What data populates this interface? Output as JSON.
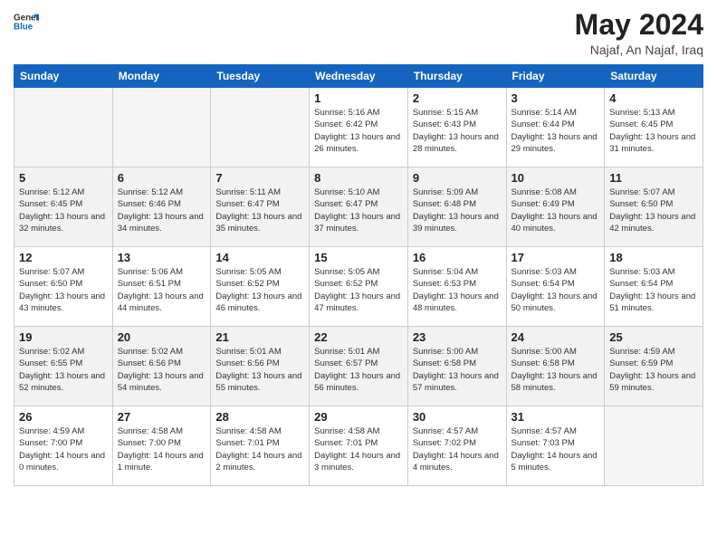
{
  "header": {
    "logo_general": "General",
    "logo_blue": "Blue",
    "title": "May 2024",
    "subtitle": "Najaf, An Najaf, Iraq"
  },
  "weekdays": [
    "Sunday",
    "Monday",
    "Tuesday",
    "Wednesday",
    "Thursday",
    "Friday",
    "Saturday"
  ],
  "weeks": [
    [
      {
        "day": "",
        "sunrise": "",
        "sunset": "",
        "daylight": ""
      },
      {
        "day": "",
        "sunrise": "",
        "sunset": "",
        "daylight": ""
      },
      {
        "day": "",
        "sunrise": "",
        "sunset": "",
        "daylight": ""
      },
      {
        "day": "1",
        "sunrise": "Sunrise: 5:16 AM",
        "sunset": "Sunset: 6:42 PM",
        "daylight": "Daylight: 13 hours and 26 minutes."
      },
      {
        "day": "2",
        "sunrise": "Sunrise: 5:15 AM",
        "sunset": "Sunset: 6:43 PM",
        "daylight": "Daylight: 13 hours and 28 minutes."
      },
      {
        "day": "3",
        "sunrise": "Sunrise: 5:14 AM",
        "sunset": "Sunset: 6:44 PM",
        "daylight": "Daylight: 13 hours and 29 minutes."
      },
      {
        "day": "4",
        "sunrise": "Sunrise: 5:13 AM",
        "sunset": "Sunset: 6:45 PM",
        "daylight": "Daylight: 13 hours and 31 minutes."
      }
    ],
    [
      {
        "day": "5",
        "sunrise": "Sunrise: 5:12 AM",
        "sunset": "Sunset: 6:45 PM",
        "daylight": "Daylight: 13 hours and 32 minutes."
      },
      {
        "day": "6",
        "sunrise": "Sunrise: 5:12 AM",
        "sunset": "Sunset: 6:46 PM",
        "daylight": "Daylight: 13 hours and 34 minutes."
      },
      {
        "day": "7",
        "sunrise": "Sunrise: 5:11 AM",
        "sunset": "Sunset: 6:47 PM",
        "daylight": "Daylight: 13 hours and 35 minutes."
      },
      {
        "day": "8",
        "sunrise": "Sunrise: 5:10 AM",
        "sunset": "Sunset: 6:47 PM",
        "daylight": "Daylight: 13 hours and 37 minutes."
      },
      {
        "day": "9",
        "sunrise": "Sunrise: 5:09 AM",
        "sunset": "Sunset: 6:48 PM",
        "daylight": "Daylight: 13 hours and 39 minutes."
      },
      {
        "day": "10",
        "sunrise": "Sunrise: 5:08 AM",
        "sunset": "Sunset: 6:49 PM",
        "daylight": "Daylight: 13 hours and 40 minutes."
      },
      {
        "day": "11",
        "sunrise": "Sunrise: 5:07 AM",
        "sunset": "Sunset: 6:50 PM",
        "daylight": "Daylight: 13 hours and 42 minutes."
      }
    ],
    [
      {
        "day": "12",
        "sunrise": "Sunrise: 5:07 AM",
        "sunset": "Sunset: 6:50 PM",
        "daylight": "Daylight: 13 hours and 43 minutes."
      },
      {
        "day": "13",
        "sunrise": "Sunrise: 5:06 AM",
        "sunset": "Sunset: 6:51 PM",
        "daylight": "Daylight: 13 hours and 44 minutes."
      },
      {
        "day": "14",
        "sunrise": "Sunrise: 5:05 AM",
        "sunset": "Sunset: 6:52 PM",
        "daylight": "Daylight: 13 hours and 46 minutes."
      },
      {
        "day": "15",
        "sunrise": "Sunrise: 5:05 AM",
        "sunset": "Sunset: 6:52 PM",
        "daylight": "Daylight: 13 hours and 47 minutes."
      },
      {
        "day": "16",
        "sunrise": "Sunrise: 5:04 AM",
        "sunset": "Sunset: 6:53 PM",
        "daylight": "Daylight: 13 hours and 48 minutes."
      },
      {
        "day": "17",
        "sunrise": "Sunrise: 5:03 AM",
        "sunset": "Sunset: 6:54 PM",
        "daylight": "Daylight: 13 hours and 50 minutes."
      },
      {
        "day": "18",
        "sunrise": "Sunrise: 5:03 AM",
        "sunset": "Sunset: 6:54 PM",
        "daylight": "Daylight: 13 hours and 51 minutes."
      }
    ],
    [
      {
        "day": "19",
        "sunrise": "Sunrise: 5:02 AM",
        "sunset": "Sunset: 6:55 PM",
        "daylight": "Daylight: 13 hours and 52 minutes."
      },
      {
        "day": "20",
        "sunrise": "Sunrise: 5:02 AM",
        "sunset": "Sunset: 6:56 PM",
        "daylight": "Daylight: 13 hours and 54 minutes."
      },
      {
        "day": "21",
        "sunrise": "Sunrise: 5:01 AM",
        "sunset": "Sunset: 6:56 PM",
        "daylight": "Daylight: 13 hours and 55 minutes."
      },
      {
        "day": "22",
        "sunrise": "Sunrise: 5:01 AM",
        "sunset": "Sunset: 6:57 PM",
        "daylight": "Daylight: 13 hours and 56 minutes."
      },
      {
        "day": "23",
        "sunrise": "Sunrise: 5:00 AM",
        "sunset": "Sunset: 6:58 PM",
        "daylight": "Daylight: 13 hours and 57 minutes."
      },
      {
        "day": "24",
        "sunrise": "Sunrise: 5:00 AM",
        "sunset": "Sunset: 6:58 PM",
        "daylight": "Daylight: 13 hours and 58 minutes."
      },
      {
        "day": "25",
        "sunrise": "Sunrise: 4:59 AM",
        "sunset": "Sunset: 6:59 PM",
        "daylight": "Daylight: 13 hours and 59 minutes."
      }
    ],
    [
      {
        "day": "26",
        "sunrise": "Sunrise: 4:59 AM",
        "sunset": "Sunset: 7:00 PM",
        "daylight": "Daylight: 14 hours and 0 minutes."
      },
      {
        "day": "27",
        "sunrise": "Sunrise: 4:58 AM",
        "sunset": "Sunset: 7:00 PM",
        "daylight": "Daylight: 14 hours and 1 minute."
      },
      {
        "day": "28",
        "sunrise": "Sunrise: 4:58 AM",
        "sunset": "Sunset: 7:01 PM",
        "daylight": "Daylight: 14 hours and 2 minutes."
      },
      {
        "day": "29",
        "sunrise": "Sunrise: 4:58 AM",
        "sunset": "Sunset: 7:01 PM",
        "daylight": "Daylight: 14 hours and 3 minutes."
      },
      {
        "day": "30",
        "sunrise": "Sunrise: 4:57 AM",
        "sunset": "Sunset: 7:02 PM",
        "daylight": "Daylight: 14 hours and 4 minutes."
      },
      {
        "day": "31",
        "sunrise": "Sunrise: 4:57 AM",
        "sunset": "Sunset: 7:03 PM",
        "daylight": "Daylight: 14 hours and 5 minutes."
      },
      {
        "day": "",
        "sunrise": "",
        "sunset": "",
        "daylight": ""
      }
    ]
  ]
}
